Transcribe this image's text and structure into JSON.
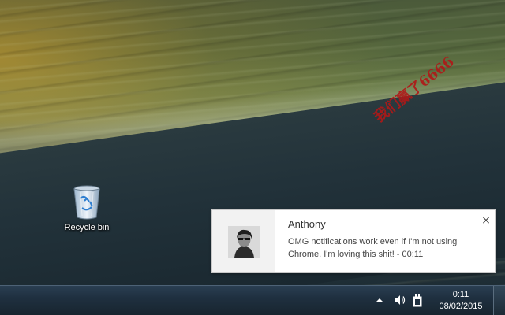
{
  "desktop": {
    "watermark_text": "我们赢了6666",
    "icons": [
      {
        "label": "Recycle bin",
        "icon": "recycle-bin-icon"
      }
    ]
  },
  "notification": {
    "title": "Anthony",
    "body": "OMG notifications work even if I'm not using Chrome. I'm loving this shit! - 00:11",
    "close_glyph": "×",
    "avatar": "avatar-photo"
  },
  "taskbar": {
    "tray_icons": [
      "chevron-up-icon",
      "speaker-icon",
      "power-plug-icon"
    ],
    "clock": {
      "time": "0:11",
      "date": "08/02/2015"
    }
  },
  "colors": {
    "watermark": "#b01818",
    "notification_bg": "#ffffff",
    "taskbar": "#1f3040"
  }
}
